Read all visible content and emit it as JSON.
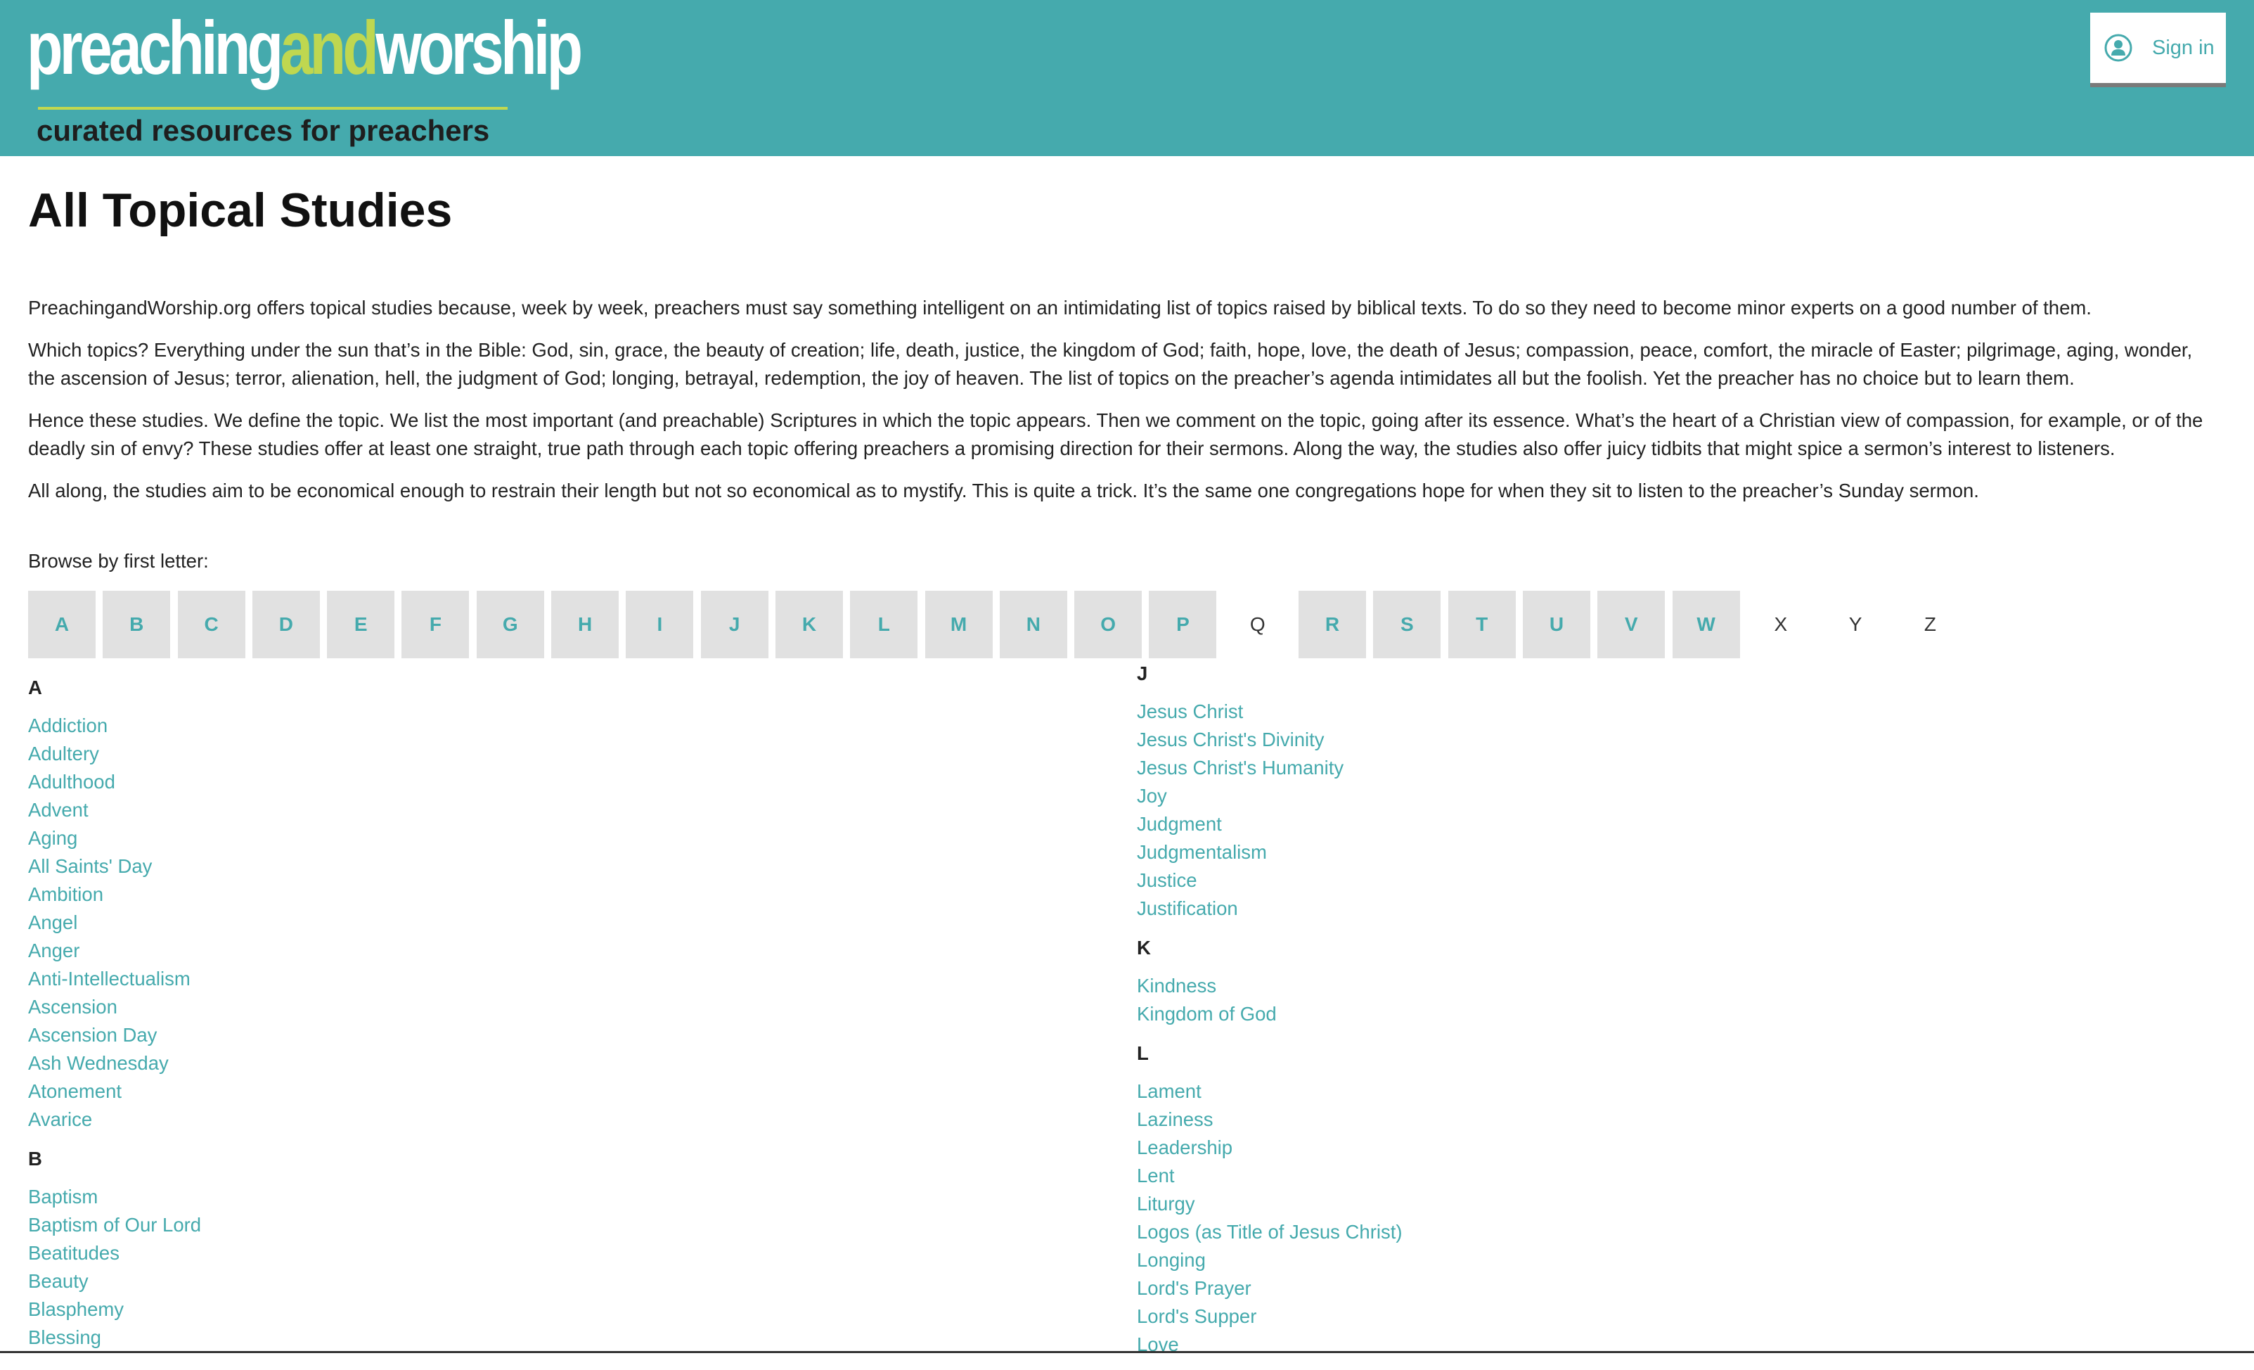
{
  "header": {
    "logo": {
      "word1": "preaching",
      "word2": "and",
      "word3": "worship",
      "tagline": "curated resources for preachers"
    },
    "signin": {
      "label": "Sign in",
      "icon": "user-circle-icon"
    },
    "colors": {
      "brand": "#45aaad",
      "accent": "#bfd750",
      "link": "#45aaad"
    }
  },
  "page": {
    "title": "All Topical Studies",
    "paragraphs": [
      "PreachingandWorship.org offers topical studies because, week by week, preachers must say something intelligent on an intimidating list of topics raised by biblical texts. To do so they need to become minor experts on a good number of them.",
      "Which topics? Everything under the sun that’s in the Bible: God, sin, grace, the beauty of creation; life, death, justice, the kingdom of God; faith, hope, love, the death of Jesus; compassion, peace, comfort, the miracle of Easter; pilgrimage, aging, wonder, the ascension of Jesus; terror, alienation, hell, the judgment of God; longing, betrayal, redemption, the joy of heaven. The list of topics on the preacher’s agenda intimidates all but the foolish. Yet the preacher has no choice but to learn them.",
      "Hence these studies. We define the topic. We list the most important (and preachable) Scriptures in which the topic appears. Then we comment on the topic, going after its essence. What’s the heart of a Christian view of compassion, for example, or of the deadly sin of envy? These studies offer at least one straight, true path through each topic offering preachers a promising direction for their sermons. Along the way, the studies also offer juicy tidbits that might spice a sermon’s interest to listeners.",
      "All along, the studies aim to be economical enough to restrain their length but not so economical as to mystify. This is quite a trick. It’s the same one congregations hope for when they sit to listen to the preacher’s Sunday sermon."
    ],
    "browse_label": "Browse by first letter:",
    "letters": [
      {
        "letter": "A",
        "link": true
      },
      {
        "letter": "B",
        "link": true
      },
      {
        "letter": "C",
        "link": true
      },
      {
        "letter": "D",
        "link": true
      },
      {
        "letter": "E",
        "link": true
      },
      {
        "letter": "F",
        "link": true
      },
      {
        "letter": "G",
        "link": true
      },
      {
        "letter": "H",
        "link": true
      },
      {
        "letter": "I",
        "link": true
      },
      {
        "letter": "J",
        "link": true
      },
      {
        "letter": "K",
        "link": true
      },
      {
        "letter": "L",
        "link": true
      },
      {
        "letter": "M",
        "link": true
      },
      {
        "letter": "N",
        "link": true
      },
      {
        "letter": "O",
        "link": true
      },
      {
        "letter": "P",
        "link": true
      },
      {
        "letter": "Q",
        "link": false
      },
      {
        "letter": "R",
        "link": true
      },
      {
        "letter": "S",
        "link": true
      },
      {
        "letter": "T",
        "link": true
      },
      {
        "letter": "U",
        "link": true
      },
      {
        "letter": "V",
        "link": true
      },
      {
        "letter": "W",
        "link": true
      },
      {
        "letter": "X",
        "link": false
      },
      {
        "letter": "Y",
        "link": false
      },
      {
        "letter": "Z",
        "link": false
      }
    ],
    "left_column": [
      {
        "heading": "A",
        "items": [
          "Addiction",
          "Adultery",
          "Adulthood",
          "Advent",
          "Aging",
          "All Saints' Day",
          "Ambition",
          "Angel",
          "Anger",
          "Anti-Intellectualism",
          "Ascension",
          "Ascension Day",
          "Ash Wednesday",
          "Atonement",
          "Avarice"
        ]
      },
      {
        "heading": "B",
        "items": [
          "Baptism",
          "Baptism of Our Lord",
          "Beatitudes",
          "Beauty",
          "Blasphemy",
          "Blessing"
        ]
      }
    ],
    "right_column": [
      {
        "heading": "J",
        "items": [
          "Jesus Christ",
          "Jesus Christ's Divinity",
          "Jesus Christ's Humanity",
          "Joy",
          "Judgment",
          "Judgmentalism",
          "Justice",
          "Justification"
        ]
      },
      {
        "heading": "K",
        "items": [
          "Kindness",
          "Kingdom of God"
        ]
      },
      {
        "heading": "L",
        "items": [
          "Lament",
          "Laziness",
          "Leadership",
          "Lent",
          "Liturgy",
          "Logos (as Title of Jesus Christ)",
          "Longing",
          "Lord's Prayer",
          "Lord's Supper",
          "Love"
        ]
      }
    ]
  }
}
